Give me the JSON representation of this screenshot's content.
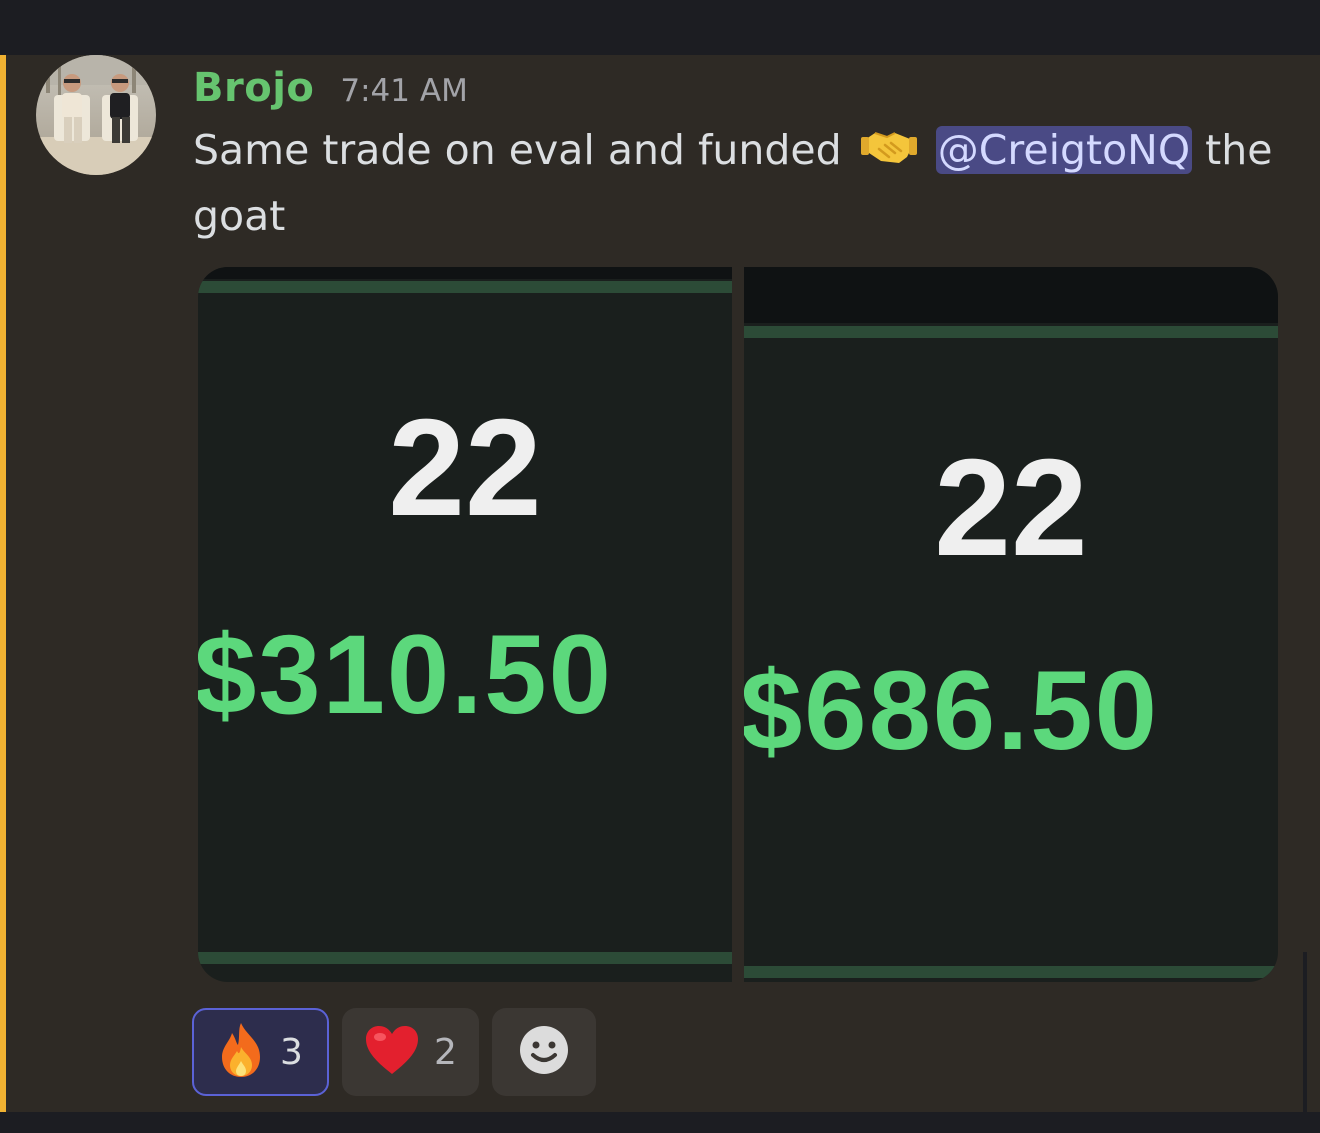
{
  "message": {
    "author": "Brojo",
    "author_color": "#66c46f",
    "timestamp": "7:41 AM",
    "text_before": "Same trade on eval and funded",
    "emoji_handshake": "handshake-emoji",
    "mention": "@CreigtoNQ",
    "text_after": "the",
    "text_wrap": "goat",
    "highlight_color": "#f0b232"
  },
  "attachments": [
    {
      "count": "22",
      "amount": "$310.50"
    },
    {
      "count": "22",
      "amount": "$686.50"
    }
  ],
  "reactions": [
    {
      "emoji": "fire-emoji",
      "count": "3",
      "selected": true
    },
    {
      "emoji": "red-heart-emoji",
      "count": "2",
      "selected": false
    },
    {
      "emoji": "add-reaction-icon",
      "count": "",
      "selected": false
    }
  ]
}
